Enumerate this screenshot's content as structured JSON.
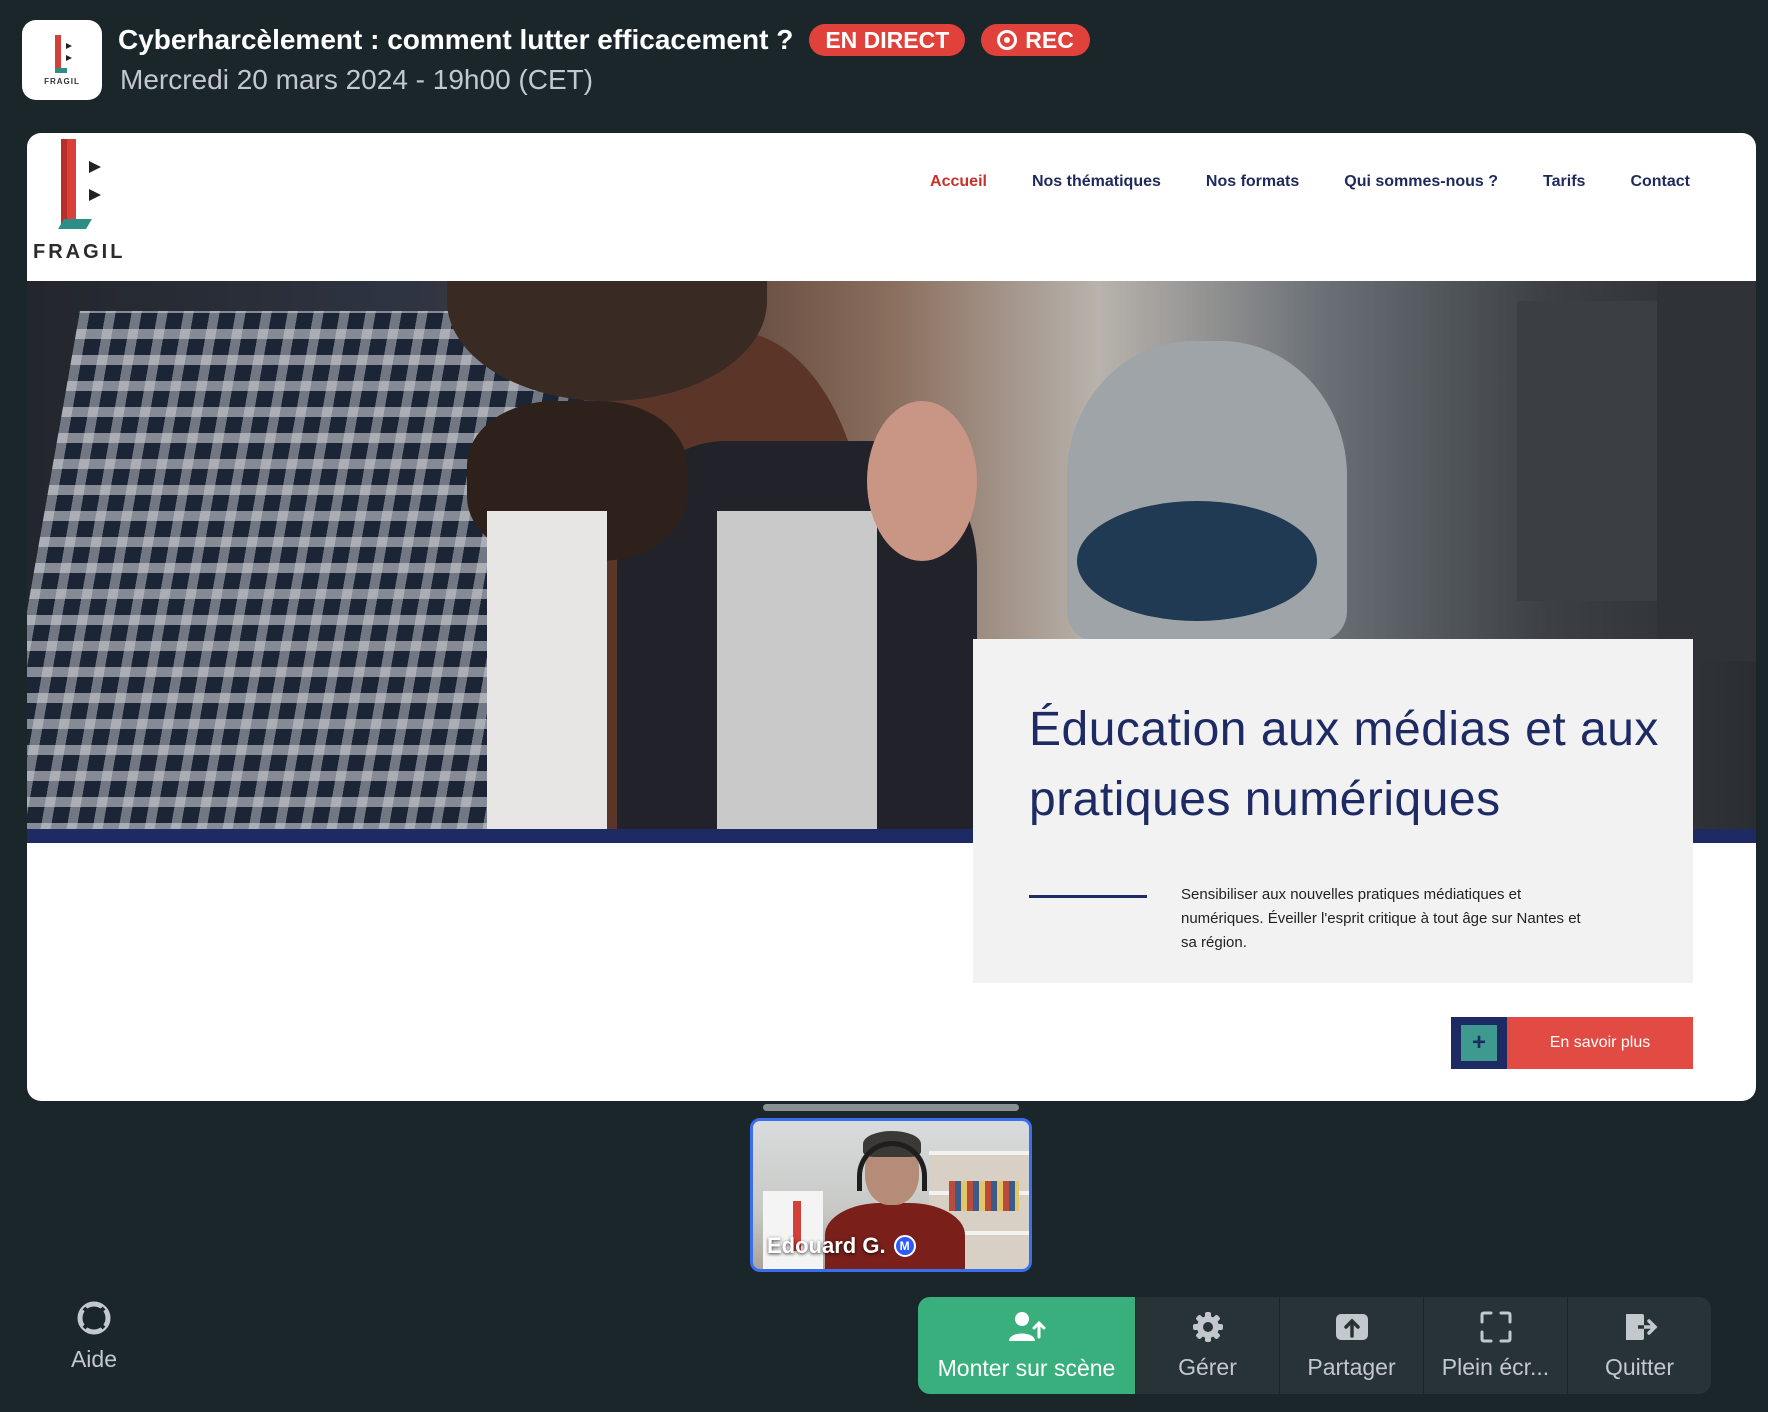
{
  "event": {
    "title": "Cyberharcèlement : comment lutter efficacement ?",
    "date": "Mercredi 20 mars 2024 - 19h00 (CET)",
    "live_badge": "EN DIRECT",
    "rec_badge": "REC",
    "logo_text": "FRAGIL"
  },
  "shared_screen": {
    "site_logo_text": "FRAGIL",
    "nav": [
      "Accueil",
      "Nos thématiques",
      "Nos formats",
      "Qui sommes-nous ?",
      "Tarifs",
      "Contact"
    ],
    "active_nav": "Accueil",
    "hero_heading": "Éducation aux médias et aux pratiques numériques",
    "hero_description": "Sensibiliser aux nouvelles pratiques médiatiques et numériques. Éveiller l'esprit critique à tout âge sur Nantes et sa région.",
    "cta_label": "En savoir plus"
  },
  "speaker": {
    "name": "Edouard G.",
    "role_badge": "M"
  },
  "toolbar": {
    "help": "Aide",
    "stage": "Monter sur scène",
    "manage": "Gérer",
    "share": "Partager",
    "fullscreen": "Plein écr...",
    "quit": "Quitter"
  },
  "colors": {
    "background": "#1b262b",
    "live_red": "#e0413a",
    "primary_green": "#3aaf7e",
    "site_navy": "#1e2a63",
    "site_red": "#c8302c",
    "speaker_border": "#3a6df0"
  },
  "icons": [
    "help-lifebuoy-icon",
    "stage-user-up-icon",
    "gear-icon",
    "share-upload-icon",
    "fullscreen-icon",
    "exit-icon",
    "record-icon"
  ]
}
